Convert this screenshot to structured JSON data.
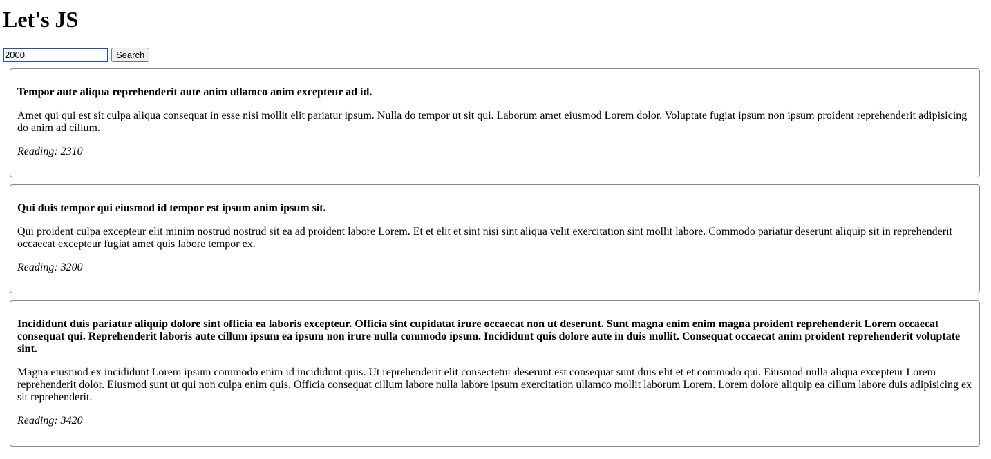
{
  "page": {
    "title": "Let's JS"
  },
  "search": {
    "value": "2000",
    "button_label": "Search"
  },
  "posts": [
    {
      "title": "Tempor aute aliqua reprehenderit aute anim ullamco anim excepteur ad id.",
      "body": "Amet qui qui est sit culpa aliqua consequat in esse nisi mollit elit pariatur ipsum. Nulla do tempor ut sit qui. Laborum amet eiusmod Lorem dolor. Voluptate fugiat ipsum non ipsum proident reprehenderit adipisicing do anim ad cillum.",
      "reading_label": "Reading:",
      "reading_value": "2310"
    },
    {
      "title": "Qui duis tempor qui eiusmod id tempor est ipsum anim ipsum sit.",
      "body": "Qui proident culpa excepteur elit minim nostrud nostrud sit ea ad proident labore Lorem. Et et elit et sint nisi sint aliqua velit exercitation sint mollit labore. Commodo pariatur deserunt aliquip sit in reprehenderit occaecat excepteur fugiat amet quis labore tempor ex.",
      "reading_label": "Reading:",
      "reading_value": "3200"
    },
    {
      "title": "Incididunt duis pariatur aliquip dolore sint officia ea laboris excepteur. Officia sint cupidatat irure occaecat non ut deserunt. Sunt magna enim enim magna proident reprehenderit Lorem occaecat consequat qui. Reprehenderit laboris aute cillum ipsum ea ipsum non irure nulla commodo ipsum. Incididunt quis dolore aute in duis mollit. Consequat occaecat anim proident reprehenderit voluptate sint.",
      "body": "Magna eiusmod ex incididunt Lorem ipsum commodo enim id incididunt quis. Ut reprehenderit elit consectetur deserunt est consequat sunt duis elit et et commodo qui. Eiusmod nulla aliqua excepteur Lorem reprehenderit dolor. Eiusmod sunt ut qui non culpa enim quis. Officia consequat cillum labore nulla labore ipsum exercitation ullamco mollit laborum Lorem. Lorem dolore aliquip ea cillum labore duis adipisicing ex sit reprehenderit.",
      "reading_label": "Reading:",
      "reading_value": "3420"
    }
  ]
}
